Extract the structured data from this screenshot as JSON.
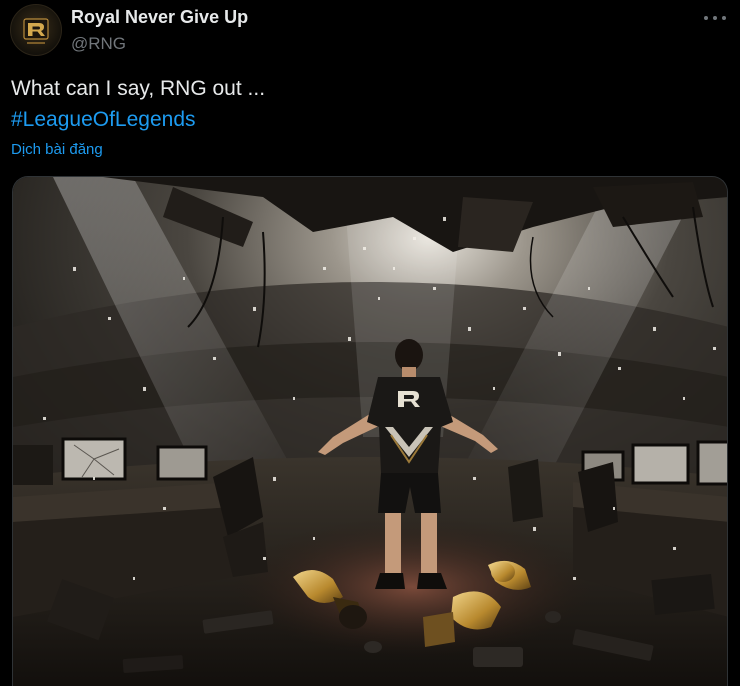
{
  "tweet": {
    "author_name": "Royal Never Give Up",
    "author_handle": "@RNG",
    "text": "What can I say, RNG out ...",
    "hashtag": "#LeagueOfLegends",
    "translate_label": "Dịch bài đăng",
    "more_icon": "more-horizontal-icon",
    "avatar_icon": "rng-logo"
  },
  "colors": {
    "background": "#000000",
    "text_primary": "#e7e9ea",
    "text_secondary": "#71767b",
    "link": "#1d9bf0"
  },
  "media": {
    "image": "arena-photo",
    "jersey_logo": "rng-logo"
  }
}
